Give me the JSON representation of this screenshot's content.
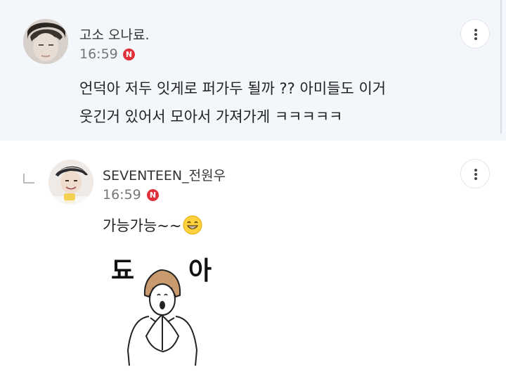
{
  "comment": {
    "author": "고소 오나료.",
    "time": "16:59",
    "badge": "N",
    "text_line1": "언덕아 저두 잇게로 퍼가두 될까 ?? 아미들도 이거",
    "text_line2": "웃긴거 있어서 모아서 가져가게 ㅋㅋㅋㅋㅋ"
  },
  "reply": {
    "author": "SEVENTEEN_전원우",
    "time": "16:59",
    "badge": "N",
    "text": "가능가능~~",
    "sticker_letter_1": "됴",
    "sticker_letter_2": "아"
  },
  "colors": {
    "highlight_background": "#f3f6fb",
    "new_badge": "#e0313b"
  }
}
